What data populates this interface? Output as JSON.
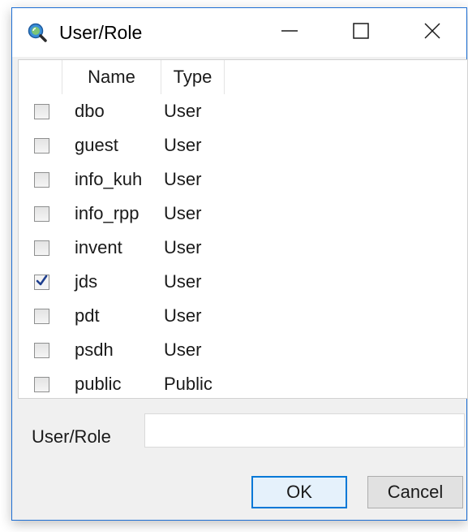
{
  "window": {
    "title": "User/Role",
    "app_icon": "search-magnifier-icon",
    "controls": {
      "minimize": "minimize-icon",
      "maximize": "maximize-icon",
      "close": "close-icon"
    }
  },
  "list": {
    "columns": {
      "name": "Name",
      "type": "Type"
    },
    "rows": [
      {
        "name": "dbo",
        "type": "User",
        "checked": false
      },
      {
        "name": "guest",
        "type": "User",
        "checked": false
      },
      {
        "name": "info_kuh",
        "type": "User",
        "checked": false
      },
      {
        "name": "info_rpp",
        "type": "User",
        "checked": false
      },
      {
        "name": "invent",
        "type": "User",
        "checked": false
      },
      {
        "name": "jds",
        "type": "User",
        "checked": true
      },
      {
        "name": "pdt",
        "type": "User",
        "checked": false
      },
      {
        "name": "psdh",
        "type": "User",
        "checked": false
      },
      {
        "name": "public",
        "type": "Public",
        "checked": false
      }
    ]
  },
  "field": {
    "label": "User/Role",
    "value": ""
  },
  "buttons": {
    "ok": "OK",
    "cancel": "Cancel"
  },
  "colors": {
    "accent": "#0078d7",
    "checkmark": "#1f3f8f"
  }
}
